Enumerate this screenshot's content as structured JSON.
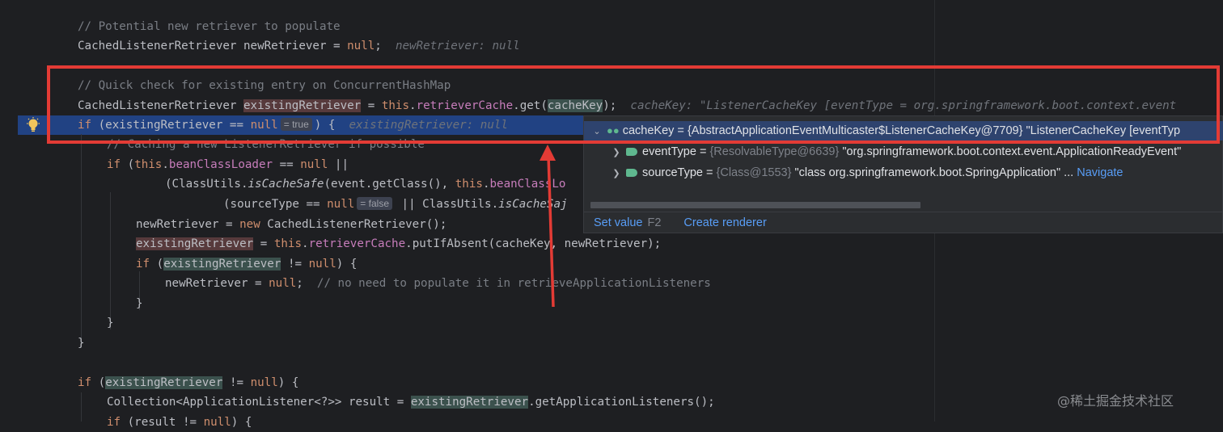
{
  "code": {
    "l1": "// Potential new retriever to populate",
    "l2_type": "CachedListenerRetriever newRetriever = ",
    "l2_null": "null",
    "l2_semi": ";",
    "l2_inlay": "newRetriever: null",
    "l3": "// Quick check for existing entry on ConcurrentHashMap",
    "l4_type": "CachedListenerRetriever ",
    "l4_var": "existingRetriever",
    "l4_eq": " = ",
    "l4_this": "this",
    "l4_dot": ".",
    "l4_field": "retrieverCache",
    "l4_get": ".get(",
    "l4_arg": "cacheKey",
    "l4_end": ");",
    "l4_inlay": "cacheKey: \"ListenerCacheKey [eventType = org.springframework.boot.context.event",
    "l5_if": "if",
    "l5_a": " (existingRetriever == ",
    "l5_null": "null",
    "l5_pill": "= true",
    "l5_b": ") {",
    "l5_inlay": "existingRetriever: null",
    "l6": "// Caching a new ListenerRetriever if possible",
    "l7_if": "if",
    "l7_a": " (",
    "l7_this": "this",
    "l7_b": ".",
    "l7_field": "beanClassLoader",
    "l7_c": " == ",
    "l7_null": "null",
    "l7_d": " ||",
    "l8_a": "(ClassUtils.",
    "l8_m": "isCacheSafe",
    "l8_b": "(event.getClass(), ",
    "l8_this": "this",
    "l8_c": ".",
    "l8_field": "beanClassLo",
    "l9_a": "(sourceType == ",
    "l9_null": "null",
    "l9_pill": "= false",
    "l9_b": " || ClassUtils.",
    "l9_m": "isCacheSaj",
    "l10_a": "newRetriever = ",
    "l10_new": "new",
    "l10_b": " CachedListenerRetriever();",
    "l11_var": "existingRetriever",
    "l11_a": " = ",
    "l11_this": "this",
    "l11_b": ".",
    "l11_field": "retrieverCache",
    "l11_c": ".putIfAbsent(cacheKey, newRetriever);",
    "l12_if": "if",
    "l12_a": " (",
    "l12_var": "existingRetriever",
    "l12_b": " != ",
    "l12_null": "null",
    "l12_c": ") {",
    "l13_a": "newRetriever = ",
    "l13_null": "null",
    "l13_b": ";  ",
    "l13_cm": "// no need to populate it in retrieveApplicationListeners",
    "l14": "}",
    "l15": "}",
    "l16": "}",
    "l18_if": "if",
    "l18_a": " (",
    "l18_var": "existingRetriever",
    "l18_b": " != ",
    "l18_null": "null",
    "l18_c": ") {",
    "l19_a": "Collection<ApplicationListener<?>> result = ",
    "l19_var": "existingRetriever",
    "l19_b": ".getApplicationListeners();",
    "l20_if": "if",
    "l20_a": " (result != ",
    "l20_null": "null",
    "l20_b": ") {"
  },
  "popup": {
    "row1_name": "cacheKey",
    "row1_eq": " = ",
    "row1_val": "{AbstractApplicationEventMulticaster$ListenerCacheKey@7709} \"ListenerCacheKey [eventTyp",
    "row2_name": "eventType",
    "row2_eq": " = ",
    "row2_type": "{ResolvableType@6639}",
    "row2_val": " \"org.springframework.boot.context.event.ApplicationReadyEvent\"",
    "row3_name": "sourceType",
    "row3_eq": " = ",
    "row3_type": "{Class@1553}",
    "row3_val": " \"class org.springframework.boot.SpringApplication\"",
    "row3_more": " ... ",
    "row3_link": "Navigate",
    "set_value": "Set value",
    "set_value_key": "F2",
    "create_renderer": "Create renderer"
  },
  "watermark": "@稀土掘金技术社区",
  "colors": {
    "annotation": "#e33b35",
    "execution_line": "#214283"
  },
  "icons": [
    "lightbulb-icon",
    "chevron-down-icon",
    "chevron-right-icon",
    "watch-glasses-icon",
    "field-tag-icon"
  ]
}
